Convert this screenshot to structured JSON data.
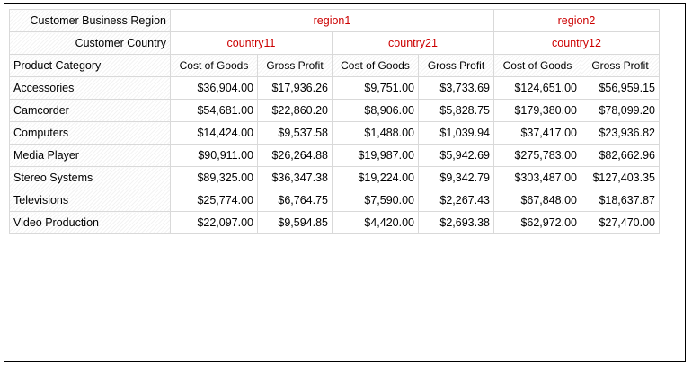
{
  "headers": {
    "region_label": "Customer Business Region",
    "country_label": "Customer Country",
    "category_label": "Product Category"
  },
  "regions": [
    {
      "name": "region1"
    },
    {
      "name": "region2"
    }
  ],
  "countries": [
    {
      "name": "country11"
    },
    {
      "name": "country21"
    },
    {
      "name": "country12"
    }
  ],
  "measures": {
    "cost": "Cost of Goods",
    "profit": "Gross Profit"
  },
  "rows": [
    {
      "category": "Accessories",
      "values": [
        "$36,904.00",
        "$17,936.26",
        "$9,751.00",
        "$3,733.69",
        "$124,651.00",
        "$56,959.15"
      ]
    },
    {
      "category": "Camcorder",
      "values": [
        "$54,681.00",
        "$22,860.20",
        "$8,906.00",
        "$5,828.75",
        "$179,380.00",
        "$78,099.20"
      ]
    },
    {
      "category": "Computers",
      "values": [
        "$14,424.00",
        "$9,537.58",
        "$1,488.00",
        "$1,039.94",
        "$37,417.00",
        "$23,936.82"
      ]
    },
    {
      "category": "Media Player",
      "values": [
        "$90,911.00",
        "$26,264.88",
        "$19,987.00",
        "$5,942.69",
        "$275,783.00",
        "$82,662.96"
      ]
    },
    {
      "category": "Stereo Systems",
      "values": [
        "$89,325.00",
        "$36,347.38",
        "$19,224.00",
        "$9,342.79",
        "$303,487.00",
        "$127,403.35"
      ]
    },
    {
      "category": "Televisions",
      "values": [
        "$25,774.00",
        "$6,764.75",
        "$7,590.00",
        "$2,267.43",
        "$67,848.00",
        "$18,637.87"
      ]
    },
    {
      "category": "Video Production",
      "values": [
        "$22,097.00",
        "$9,594.85",
        "$4,420.00",
        "$2,693.38",
        "$62,972.00",
        "$27,470.00"
      ]
    }
  ]
}
